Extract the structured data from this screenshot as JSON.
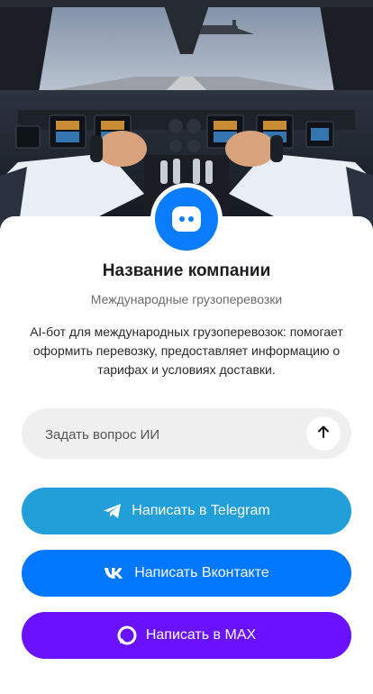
{
  "hero": {
    "icon": "airplane-cockpit-image"
  },
  "company": {
    "name": "Название компании",
    "subtitle": "Международные грузоперевозки",
    "description": "AI-бот для международных грузоперевозок: помогает оформить перевозку, предоставляет информацию о тарифах и условиях доставки."
  },
  "ask": {
    "placeholder": "Задать вопрос ИИ",
    "send_icon": "arrow-up-icon"
  },
  "buttons": {
    "telegram": "Написать в Telegram",
    "vk": "Написать Вконтакте",
    "max": "Написать в MAX"
  },
  "colors": {
    "avatar": "#0a7cff",
    "telegram": "#229ed9",
    "vk": "#0077ff",
    "max": "#6a11ff"
  }
}
